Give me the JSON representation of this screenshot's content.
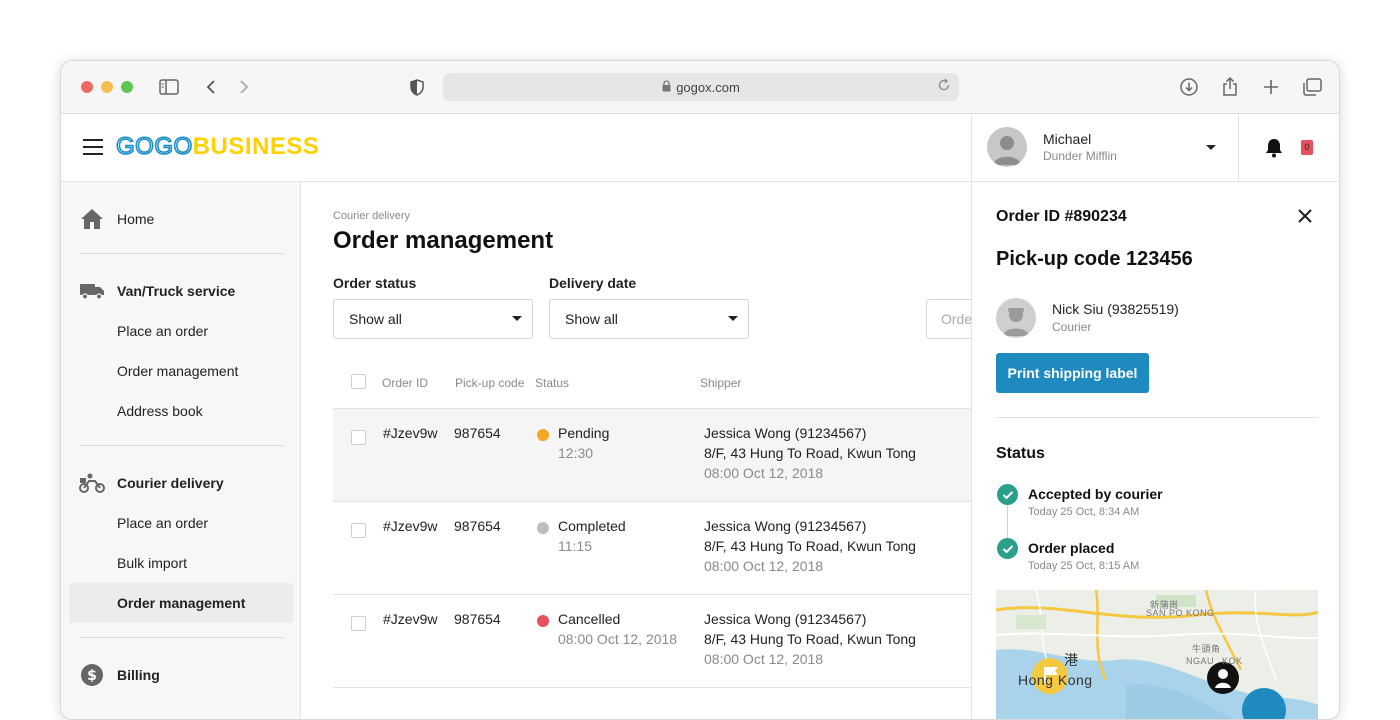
{
  "browser": {
    "url": "gogox.com"
  },
  "header": {
    "logo_part1": "GOGO",
    "logo_part2": "BUSINESS",
    "user_name": "Michael",
    "user_company": "Dunder Mifflin",
    "notification_count": "0"
  },
  "sidebar": {
    "home": "Home",
    "van_truck": {
      "title": "Van/Truck service",
      "items": [
        "Place an order",
        "Order management",
        "Address book"
      ]
    },
    "courier": {
      "title": "Courier delivery",
      "items": [
        "Place an order",
        "Bulk import",
        "Order management"
      ],
      "active_index": 2
    },
    "billing": "Billing"
  },
  "main": {
    "breadcrumb": "Courier delivery",
    "title": "Order management",
    "filters": {
      "order_status_label": "Order status",
      "order_status_value": "Show all",
      "delivery_date_label": "Delivery date",
      "delivery_date_value": "Show all",
      "search_placeholder": "Orde"
    },
    "columns": [
      "Order ID",
      "Pick-up code",
      "Status",
      "Shipper"
    ],
    "rows": [
      {
        "order_id": "#Jzev9w",
        "pickup_code": "987654",
        "status": "Pending",
        "status_sub": "12:30",
        "status_color": "#f5a623",
        "shipper_name": "Jessica Wong (91234567)",
        "shipper_address": "8/F, 43 Hung To Road, Kwun Tong",
        "shipper_time": "08:00 Oct 12, 2018"
      },
      {
        "order_id": "#Jzev9w",
        "pickup_code": "987654",
        "status": "Completed",
        "status_sub": "11:15",
        "status_color": "#bdbdbd",
        "shipper_name": "Jessica Wong (91234567)",
        "shipper_address": "8/F, 43 Hung To Road, Kwun Tong",
        "shipper_time": "08:00 Oct 12, 2018"
      },
      {
        "order_id": "#Jzev9w",
        "pickup_code": "987654",
        "status": "Cancelled",
        "status_sub": "08:00 Oct 12, 2018",
        "status_color": "#e8505b",
        "shipper_name": "Jessica Wong (91234567)",
        "shipper_address": "8/F, 43 Hung To Road, Kwun Tong",
        "shipper_time": "08:00 Oct 12, 2018"
      }
    ]
  },
  "panel": {
    "order_id": "Order ID #890234",
    "pickup_code": "Pick-up code 123456",
    "courier_name": "Nick Siu (93825519)",
    "courier_role": "Courier",
    "print_label": "Print shipping label",
    "status_heading": "Status",
    "timeline": [
      {
        "title": "Accepted by courier",
        "time": "Today 25 Oct, 8:34 AM"
      },
      {
        "title": "Order placed",
        "time": "Today 25 Oct, 8:15 AM"
      }
    ],
    "map": {
      "label_sanpokong_cn": "新蒲崗",
      "label_sanpokong": "SAN PO KONG",
      "label_hk": "Hong Kong",
      "label_hk_cn": "港",
      "label_ngau": "NGAU",
      "label_kok": "KOK",
      "label_ngau_cn": "牛頭角"
    }
  },
  "colors": {
    "accent": "#1f8ac0",
    "logo_blue": "#1a8fc9",
    "logo_yellow": "#ffd100",
    "success": "#2aa08a"
  }
}
